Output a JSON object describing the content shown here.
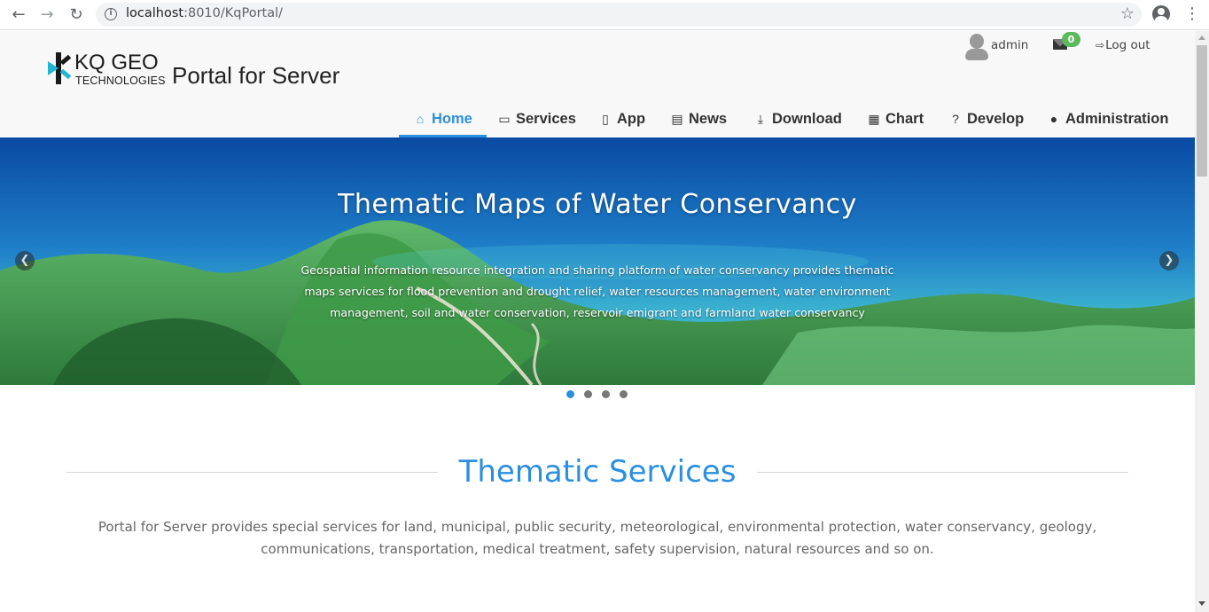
{
  "browser": {
    "url_host": "localhost",
    "url_rest": ":8010/KqPortal/",
    "icons": {
      "back": "arrow-left-icon",
      "forward": "arrow-right-icon",
      "reload": "reload-icon",
      "bookmark": "star-icon",
      "account": "account-icon",
      "menu": "kebab-menu-icon"
    }
  },
  "header": {
    "logo_main": "KQ GEO",
    "logo_sub": "TECHNOLOGIES",
    "title": "Portal for Server",
    "user": {
      "name": "admin",
      "message_count": "0",
      "logout_label": "Log out"
    }
  },
  "menu": {
    "items": [
      {
        "label": "Home",
        "icon": "home-icon",
        "glyph": "⌂",
        "active": true
      },
      {
        "label": "Services",
        "icon": "monitor-icon",
        "glyph": "▭"
      },
      {
        "label": "App",
        "icon": "phone-icon",
        "glyph": "▯"
      },
      {
        "label": "News",
        "icon": "newspaper-icon",
        "glyph": "▤"
      },
      {
        "label": "Download",
        "icon": "download-icon",
        "glyph": "⤓"
      },
      {
        "label": "Chart",
        "icon": "calendar-icon",
        "glyph": "▦"
      },
      {
        "label": "Develop",
        "icon": "question-circle-icon",
        "glyph": "?"
      },
      {
        "label": "Administration",
        "icon": "user-icon",
        "glyph": "●"
      }
    ]
  },
  "banner": {
    "title": "Thematic Maps of Water Conservancy",
    "description": "Geospatial information resource integration and sharing platform of water conservancy provides thematic maps services for flood prevention and drought relief, water resources management, water environment management, soil and water conservation, reservoir emigrant and farmland water conservancy",
    "prev_glyph": "❮",
    "next_glyph": "❯",
    "slide_count": 4,
    "active_slide": 1
  },
  "section": {
    "title": "Thematic Services",
    "description": "Portal for Server provides special services for land, municipal, public security, meteorological, environmental protection, water conservancy, geology, communications, transportation, medical treatment, safety supervision, natural resources and so on."
  },
  "colors": {
    "accent": "#2b8fe0",
    "badge": "#5cb85c"
  }
}
